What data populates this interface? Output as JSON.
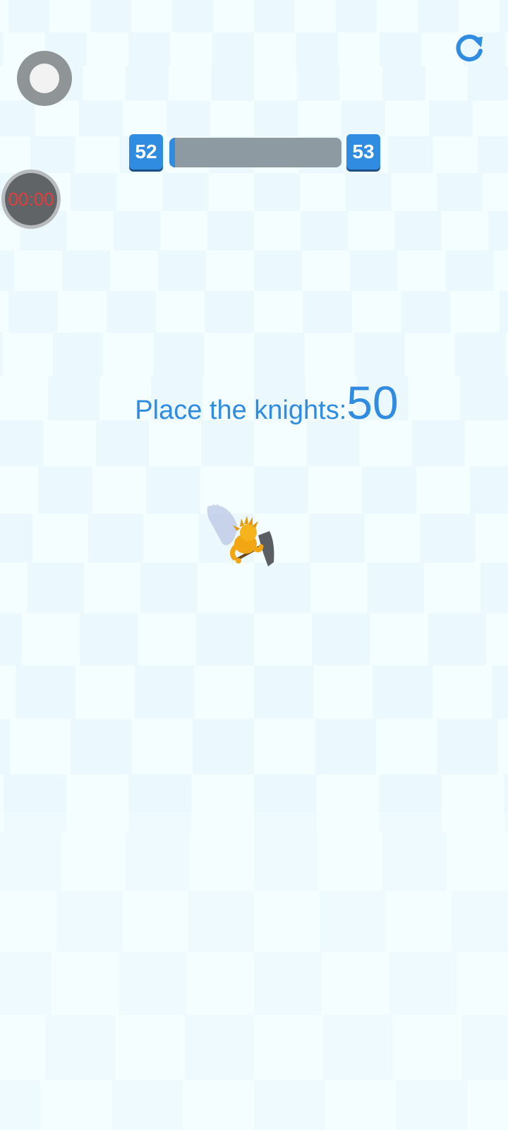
{
  "hud": {
    "timer": "00:00",
    "level": {
      "current": "52",
      "next": "53",
      "progress": 0.03
    }
  },
  "instruction": {
    "label": "Place the knights:",
    "count": "50"
  },
  "icons": {
    "record": "record-toggle-icon",
    "restart": "restart-icon",
    "knight": "knight-character"
  },
  "colors": {
    "accent": "#2f8ce0",
    "timer_text": "#e13e3e",
    "progress_track": "#8d9aa1",
    "floor_light": "#f4fdff",
    "floor_dark": "#e3f4fb",
    "knight_gold": "#f2a614"
  }
}
